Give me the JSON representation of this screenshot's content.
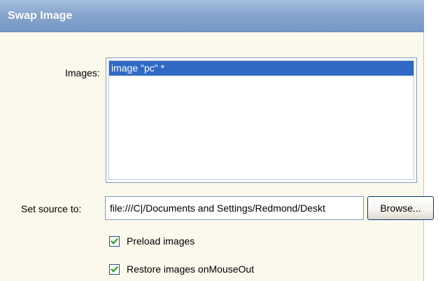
{
  "dialog": {
    "title": "Swap Image"
  },
  "images": {
    "label": "Images:",
    "items": [
      {
        "text": "image \"pc\" *",
        "selected": true
      }
    ]
  },
  "source": {
    "label": "Set source to:",
    "value": "file:///C|/Documents and Settings/Redmond/Deskt",
    "browse_label": "Browse..."
  },
  "options": {
    "preload": {
      "label": "Preload images",
      "checked": true
    },
    "restore": {
      "label": "Restore images onMouseOut",
      "checked": true
    }
  },
  "colors": {
    "title_bar": "#87a5ce",
    "selection": "#316ac5",
    "check": "#21a121"
  },
  "icons": {
    "checkmark": "check-icon"
  }
}
